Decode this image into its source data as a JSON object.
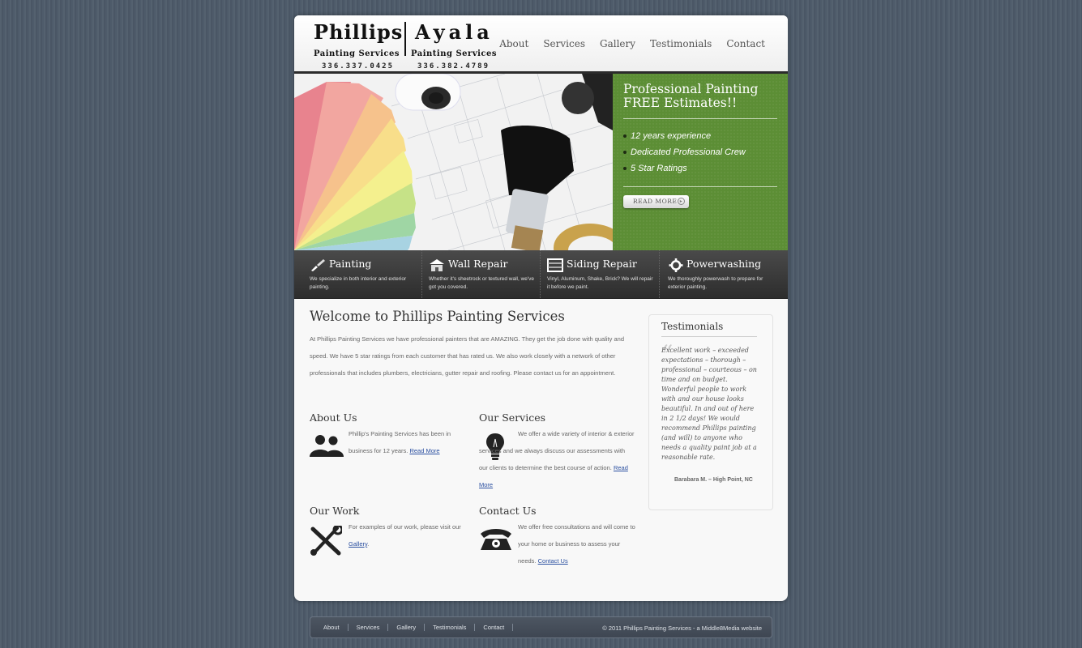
{
  "brand": {
    "left_name": "Phillips",
    "left_sub": "Painting Services",
    "left_phone": "336.337.0425",
    "right_name": "Ayala",
    "right_sub": "Painting Services",
    "right_phone": "336.382.4789"
  },
  "nav": {
    "items": [
      {
        "label": "About"
      },
      {
        "label": "Services"
      },
      {
        "label": "Gallery"
      },
      {
        "label": "Testimonials"
      },
      {
        "label": "Contact"
      }
    ]
  },
  "hero": {
    "title_line1": "Professional Painting",
    "title_line2": "FREE Estimates!!",
    "bullets": [
      "12 years experience",
      "Dedicated Professional Crew",
      "5 Star Ratings"
    ],
    "button_label": "READ MORE",
    "green": "#5c8e35"
  },
  "services": [
    {
      "title": "Painting",
      "text": "We specialize in both interior and exterior painting.",
      "icon": "paintbrush-icon"
    },
    {
      "title": "Wall Repair",
      "text": "Whether it's sheetrock or textured wall, we've got you covered.",
      "icon": "house-icon"
    },
    {
      "title": "Siding Repair",
      "text": "Vinyl, Aluminum, Shake, Brick? We will repair it before we paint.",
      "icon": "siding-icon"
    },
    {
      "title": "Powerwashing",
      "text": "We thoroughly powerwash to prepare for exterior painting.",
      "icon": "gear-icon"
    }
  ],
  "welcome": {
    "title": "Welcome to Phillips Painting Services",
    "text": "At Phillips Painting Services we have professional painters that are AMAZING. They get the job done with quality and speed. We have 5 star ratings from each customer that has rated us. We also work closely with a network of other professionals that includes plumbers, electricians, gutter repair and roofing. Please contact us for an appointment."
  },
  "about": {
    "title": "About Us",
    "text": "Phillip's Painting Services has been in business for 12 years.",
    "link": "Read More"
  },
  "our_services": {
    "title": "Our Services",
    "text": "We offer a wide variety of interior & exterior services and we always discuss our assessments with our clients to determine the best course of action.",
    "link": "Read More"
  },
  "our_work": {
    "title": "Our Work",
    "text": "For examples of our work, please visit our",
    "link": "Gallery",
    "suffix": "."
  },
  "contact": {
    "title": "Contact Us",
    "text": "We offer free consultations and will come to your home or business to assess your needs.",
    "link": "Contact Us"
  },
  "testimonials": {
    "title": "Testimonials",
    "quote": "Excellent work – exceeded expectations – thorough – professional – courteous – on time and on budget. Wonderful people to work with and our house looks beautiful. In and out of here in 2 1/2 days! We would recommend Phillips painting (and will) to anyone who needs a quality paint job at a reasonable rate.",
    "author": "Barabara M. – High Point, NC"
  },
  "footer": {
    "links": [
      {
        "label": "About"
      },
      {
        "label": "Services"
      },
      {
        "label": "Gallery"
      },
      {
        "label": "Testimonials"
      },
      {
        "label": "Contact"
      }
    ],
    "copyright": "© 2011 Phillips Painting Services - a Middle8Media website"
  }
}
